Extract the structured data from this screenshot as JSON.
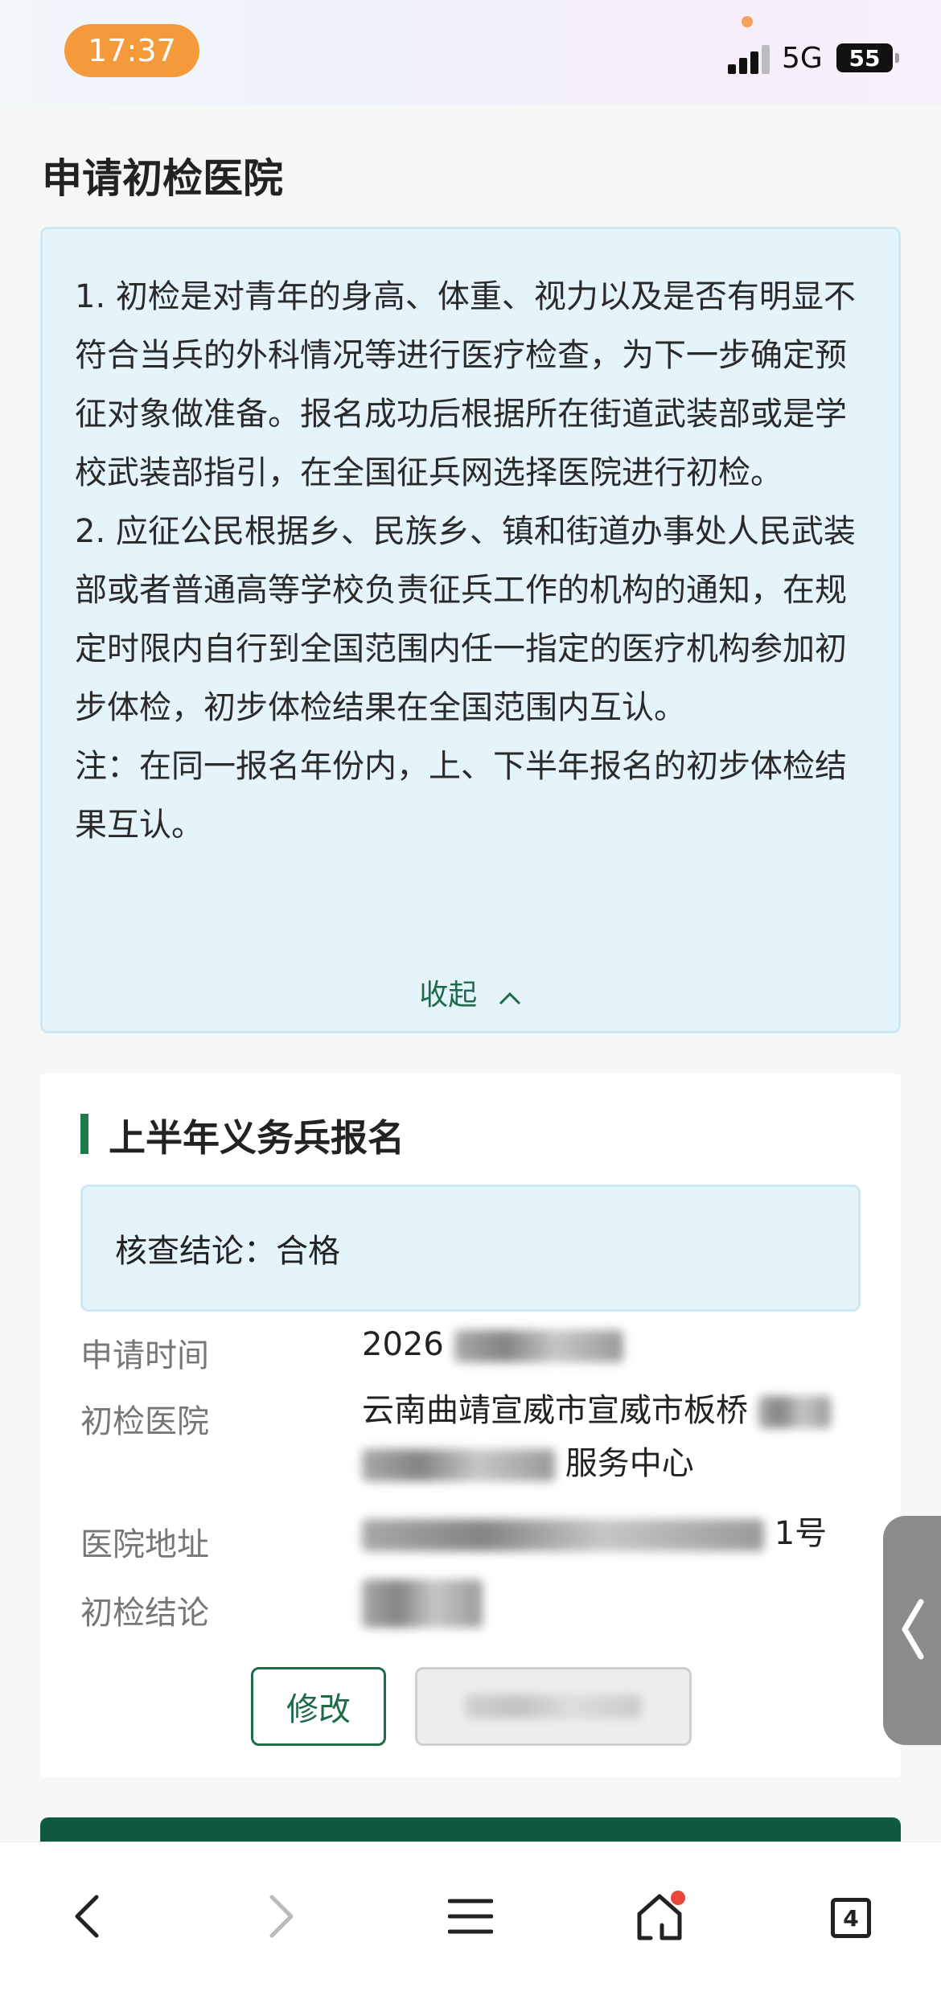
{
  "status_bar": {
    "time": "17:37",
    "network": "5G",
    "battery": "55"
  },
  "page": {
    "title": "申请初检医院"
  },
  "notice": {
    "paragraphs": [
      "1. 初检是对青年的身高、体重、视力以及是否有明显不符合当兵的外科情况等进行医疗检查，为下一步确定预征对象做准备。报名成功后根据所在街道武装部或是学校武装部指引，在全国征兵网选择医院进行初检。",
      "2. 应征公民根据乡、民族乡、镇和街道办事处人民武装部或者普通高等学校负责征兵工作的机构的通知，在规定时限内自行到全国范围内任一指定的医疗机构参加初步体检，初步体检结果在全国范围内互认。",
      "注：在同一报名年份内，上、下半年报名的初步体检结果互认。"
    ],
    "collapse_label": "收起"
  },
  "record": {
    "section_title": "上半年义务兵报名",
    "verdict": "核查结论：合格",
    "fields": {
      "apply_time_label": "申请时间",
      "apply_time_value": "2026",
      "hospital_label": "初检医院",
      "hospital_value_line1": "云南曲靖宣威市宣威市板桥",
      "hospital_value_line2": "服务中心",
      "address_label": "医院地址",
      "address_value": "1号",
      "result_label": "初检结论"
    },
    "edit_button": "修改"
  },
  "icons": {
    "back": "chevron-left-icon",
    "forward": "chevron-right-icon",
    "menu": "menu-icon",
    "home": "home-icon",
    "tabs": "tabs-icon",
    "side_handle": "chevron-left-icon"
  },
  "bottom_nav": {
    "tab_count": "4"
  },
  "colors": {
    "accent_green": "#1e6b48",
    "dark_green": "#0f5a3e",
    "notice_bg": "#e5f4fb",
    "time_pill": "#f59a3a",
    "notification_dot": "#e8453c"
  }
}
